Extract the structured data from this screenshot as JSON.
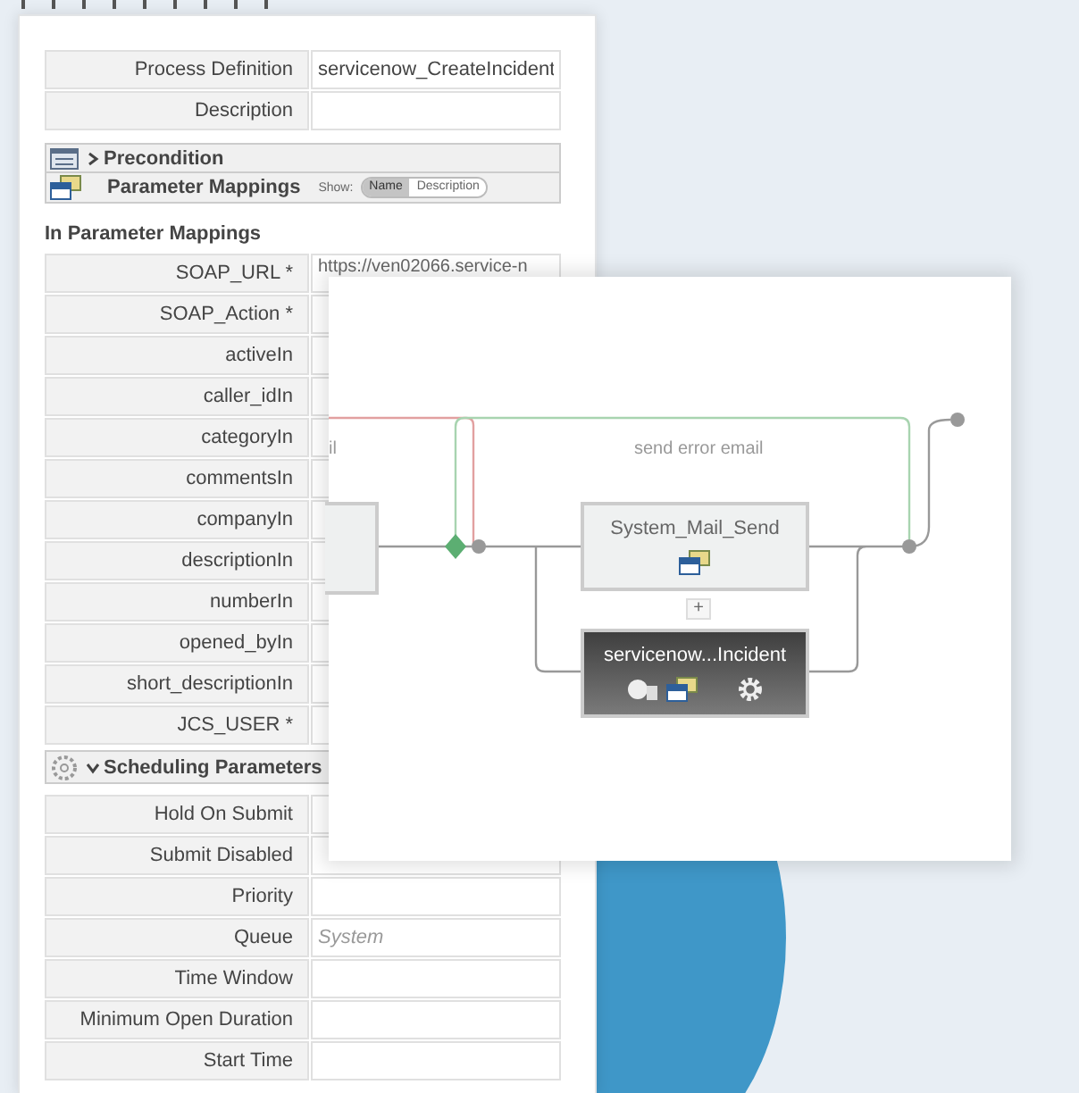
{
  "top_fields": [
    {
      "label": "Process Definition",
      "value": "servicenow_CreateIncident"
    },
    {
      "label": "Description"
    }
  ],
  "precondition": {
    "title": "Precondition",
    "expanded": false
  },
  "parameter_mappings": {
    "title": "Parameter Mappings",
    "show_label": "Show:",
    "options": [
      {
        "label": "Name",
        "selected": true
      },
      {
        "label": "Description",
        "selected": false
      }
    ]
  },
  "in_parameters": {
    "title": "In Parameter Mappings",
    "rows": [
      {
        "label": "SOAP_URL *",
        "value": "https://ven02066.service-n"
      },
      {
        "label": "SOAP_Action *"
      },
      {
        "label": "activeIn"
      },
      {
        "label": "caller_idIn"
      },
      {
        "label": "categoryIn"
      },
      {
        "label": "commentsIn"
      },
      {
        "label": "companyIn"
      },
      {
        "label": "descriptionIn"
      },
      {
        "label": "numberIn"
      },
      {
        "label": "opened_byIn"
      },
      {
        "label": "short_descriptionIn"
      },
      {
        "label": "JCS_USER *"
      }
    ]
  },
  "scheduling": {
    "title": "Scheduling Parameters",
    "expanded": true,
    "rows": [
      {
        "label": "Hold On Submit"
      },
      {
        "label": "Submit Disabled"
      },
      {
        "label": "Priority"
      },
      {
        "label": "Queue",
        "placeholder": "System"
      },
      {
        "label": "Time Window"
      },
      {
        "label": "Minimum Open Duration"
      },
      {
        "label": "Start Time"
      }
    ]
  },
  "diagram": {
    "labels": [
      "il",
      "send error email"
    ],
    "add_button": "+",
    "nodes": [
      {
        "kind": "step",
        "name": "System_Mail_Send"
      },
      {
        "kind": "call",
        "name": "servicenow...Incident"
      }
    ]
  }
}
